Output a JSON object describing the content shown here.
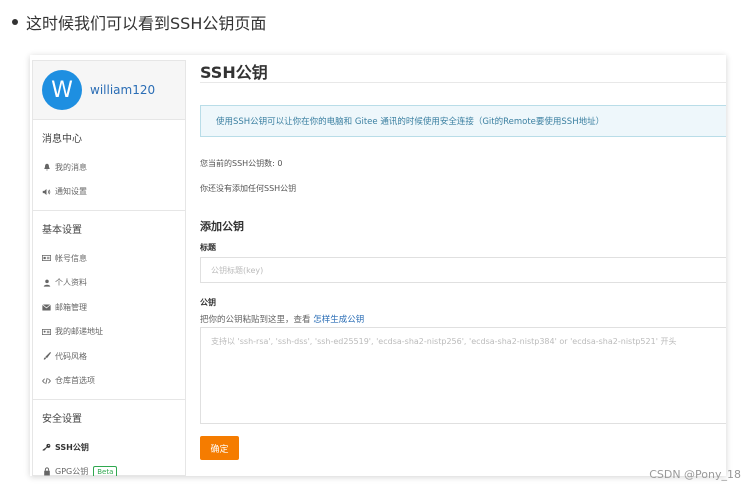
{
  "intro": {
    "text": "这时候我们可以看到SSH公钥页面"
  },
  "sidebar": {
    "user": {
      "avatar_letter": "W",
      "name": "william120"
    },
    "sections": [
      {
        "title": "消息中心",
        "items": [
          {
            "icon": "bell-icon",
            "label": "我的消息"
          },
          {
            "icon": "speaker-icon",
            "label": "通知设置"
          }
        ]
      },
      {
        "title": "基本设置",
        "items": [
          {
            "icon": "id-card-icon",
            "label": "帐号信息"
          },
          {
            "icon": "user-icon",
            "label": "个人资料"
          },
          {
            "icon": "envelope-icon",
            "label": "邮箱管理"
          },
          {
            "icon": "address-card-icon",
            "label": "我的邮递地址"
          },
          {
            "icon": "brush-icon",
            "label": "代码风格"
          },
          {
            "icon": "code-icon",
            "label": "仓库首选项"
          }
        ]
      },
      {
        "title": "安全设置",
        "items": [
          {
            "icon": "key-icon",
            "label": "SSH公钥",
            "active": true
          },
          {
            "icon": "lock-icon",
            "label": "GPG公钥",
            "badge": "Beta"
          }
        ]
      }
    ]
  },
  "main": {
    "title": "SSH公钥",
    "info": "使用SSH公钥可以让你在你的电脑和 Gitee 通讯的时候使用安全连接（Git的Remote要使用SSH地址）",
    "count_text": "您当前的SSH公钥数: 0",
    "none_text": "你还没有添加任何SSH公钥",
    "add_title": "添加公钥",
    "title_label": "标题",
    "title_placeholder": "公钥标题(key)",
    "key_label": "公钥",
    "hint_prefix": "把你的公钥粘贴到这里，查看",
    "hint_link": "怎样生成公钥",
    "key_placeholder": "支持以 'ssh-rsa', 'ssh-dss', 'ssh-ed25519', 'ecdsa-sha2-nistp256', 'ecdsa-sha2-nistp384' or 'ecdsa-sha2-nistp521' 开头",
    "confirm_label": "确定"
  },
  "watermark": "CSDN @Pony_18",
  "colors": {
    "accent": "#f57c00",
    "link": "#2a6db5",
    "avatar": "#1e8fe1",
    "beta": "#2fa84f"
  }
}
